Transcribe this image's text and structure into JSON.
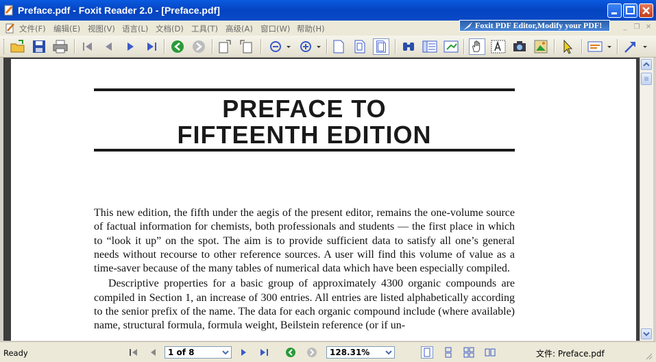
{
  "window": {
    "title": "Preface.pdf - Foxit Reader 2.0 - [Preface.pdf]"
  },
  "menu": {
    "items": [
      "文件(F)",
      "编辑(E)",
      "视图(V)",
      "语言(L)",
      "文档(D)",
      "工具(T)",
      "高级(A)",
      "窗口(W)",
      "帮助(H)"
    ]
  },
  "promo": {
    "text": "Foxit PDF Editor,Modify your PDF!"
  },
  "document": {
    "heading_line1": "PREFACE  TO",
    "heading_line2": "FIFTEENTH  EDITION",
    "paragraph1": "This new edition, the fifth under the aegis of the present editor, remains the one-volume source of factual information for chemists, both professionals and students — the first place in which to “look it up” on the spot. The aim is to provide sufficient data to satisfy all one’s general needs without recourse to other reference sources. A user will find this volume of value as a time-saver because of the many tables of numerical data which have been especially compiled.",
    "paragraph2": "Descriptive properties for a basic group of approximately 4300 organic compounds are compiled in Section 1, an increase of 300 entries. All entries are listed alphabetically according to the senior prefix of the name. The data for each organic compound include (where available) name, structural formula, formula weight, Beilstein reference (or if un-"
  },
  "status": {
    "ready": "Ready",
    "page_value": "1 of 8",
    "zoom_value": "128.31%",
    "file_label": "文件: Preface.pdf"
  },
  "icons": [
    "open-icon",
    "save-icon",
    "print-icon",
    "first-page-icon",
    "prev-page-icon",
    "next-page-icon",
    "last-page-icon",
    "back-icon",
    "forward-icon",
    "rotate-icon",
    "zoom-out-icon",
    "zoom-in-icon",
    "actual-size-icon",
    "fit-page-icon",
    "fit-width-icon",
    "find-icon",
    "bookmark-icon",
    "thumbnail-icon",
    "hand-icon",
    "text-select-icon",
    "snapshot-icon",
    "image-icon",
    "select-icon",
    "comment-icon",
    "arrow-icon"
  ]
}
